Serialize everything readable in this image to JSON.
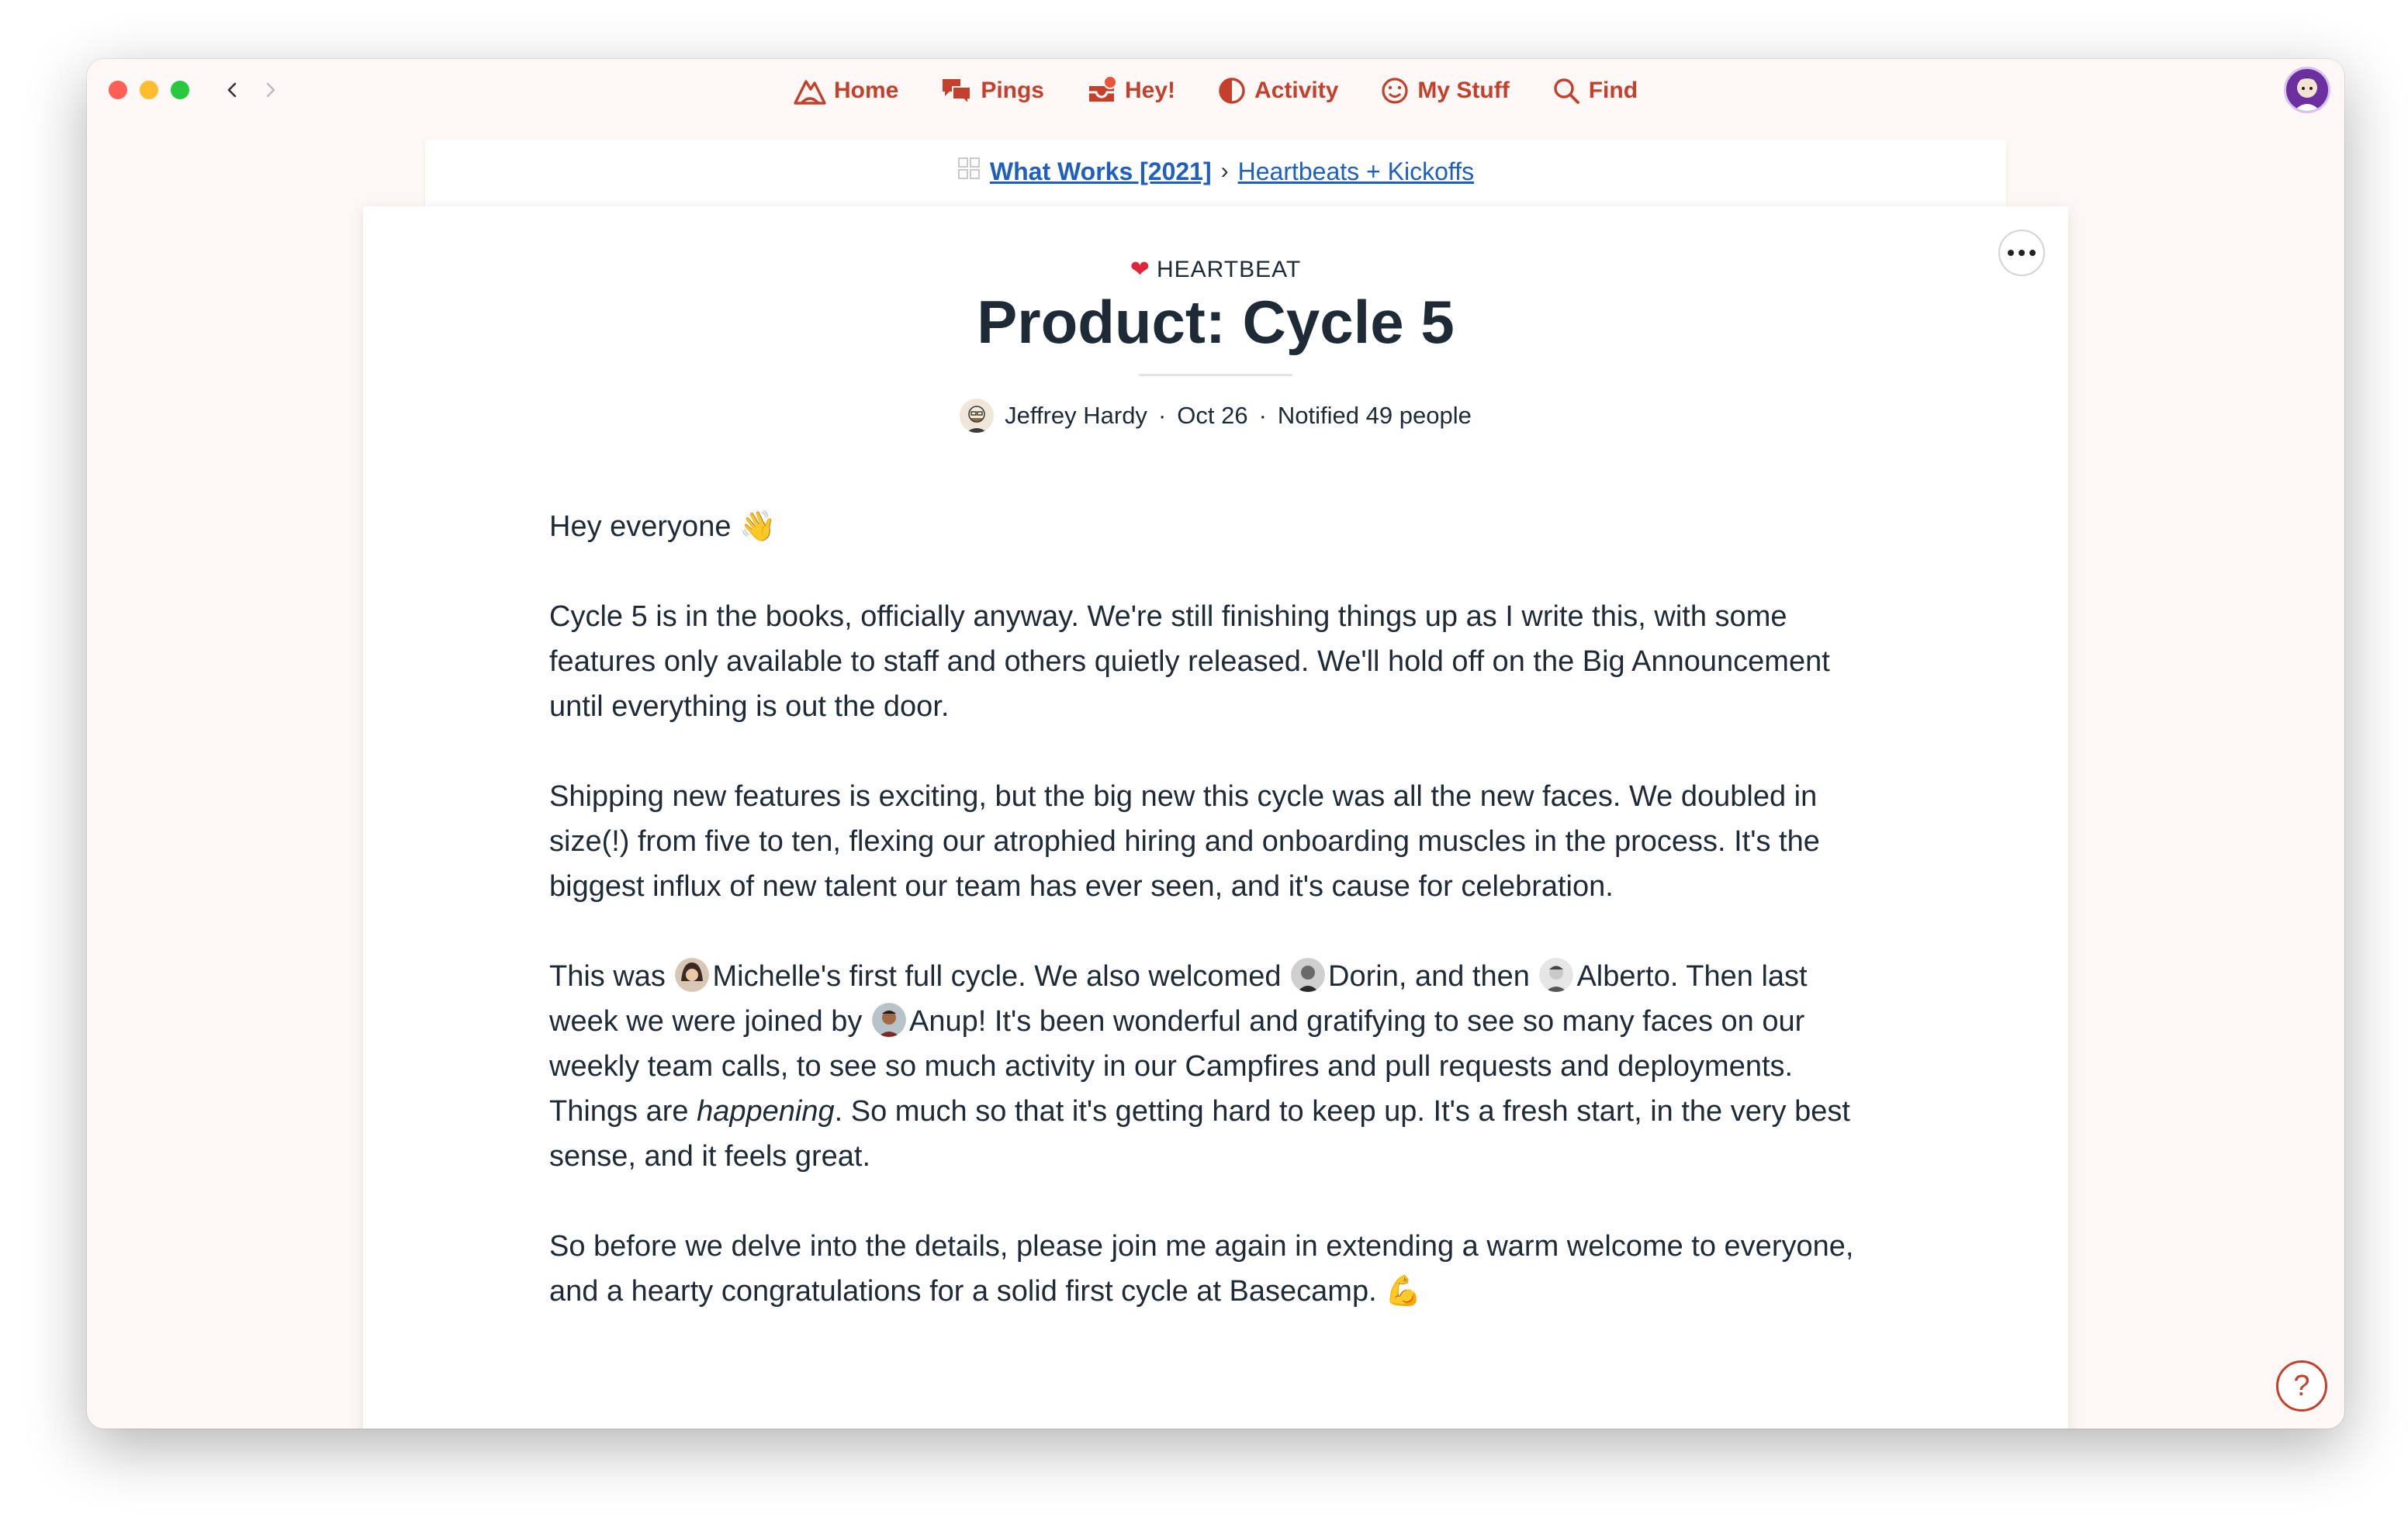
{
  "nav": {
    "home": "Home",
    "pings": "Pings",
    "hey": "Hey!",
    "activity": "Activity",
    "mystuff": "My Stuff",
    "find": "Find"
  },
  "breadcrumb": {
    "project": "What Works [2021]",
    "separator": "›",
    "section": "Heartbeats + Kickoffs"
  },
  "post": {
    "kicker": "HEARTBEAT",
    "title": "Product: Cycle 5",
    "author": "Jeffrey Hardy",
    "date": "Oct 26",
    "notified": "Notified 49 people",
    "dot": "·",
    "greeting": "Hey everyone",
    "p1": "Cycle 5 is in the books, officially anyway. We're still finishing things up as I write this, with some features only available to staff and others quietly released. We'll hold off on the Big Announcement until everything is out the door.",
    "p2": "Shipping new features is exciting, but the big new this cycle was all the new faces. We doubled in size(!) from five to ten, flexing our atrophied hiring and onboarding muscles in the process. It's the biggest influx of new talent our team has ever seen, and it's cause for celebration.",
    "p3a": "This was ",
    "p3b": "Michelle's first full cycle. We also welcomed ",
    "p3c": "Dorin, and then ",
    "p3d": "Alberto. Then last week we were joined by ",
    "p3e": "Anup! It's been wonderful and gratifying to see so many faces on our weekly team calls, to see so much activity in our Campfires and pull requests and deployments. Things are ",
    "p3f": "happening",
    "p3g": ". So much so that it's getting hard to keep up. It's a fresh start, in the very best sense, and it feels great.",
    "p4": "So before we delve into the details, please join me again in extending a warm welcome to everyone, and a hearty congratulations for a solid first cycle at Basecamp.",
    "wave_emoji": "👋",
    "muscle_emoji": "💪"
  },
  "help": "?",
  "colors": {
    "accent": "#c4402c",
    "link": "#1f5fbf",
    "window_bg": "#fdf8f5"
  }
}
